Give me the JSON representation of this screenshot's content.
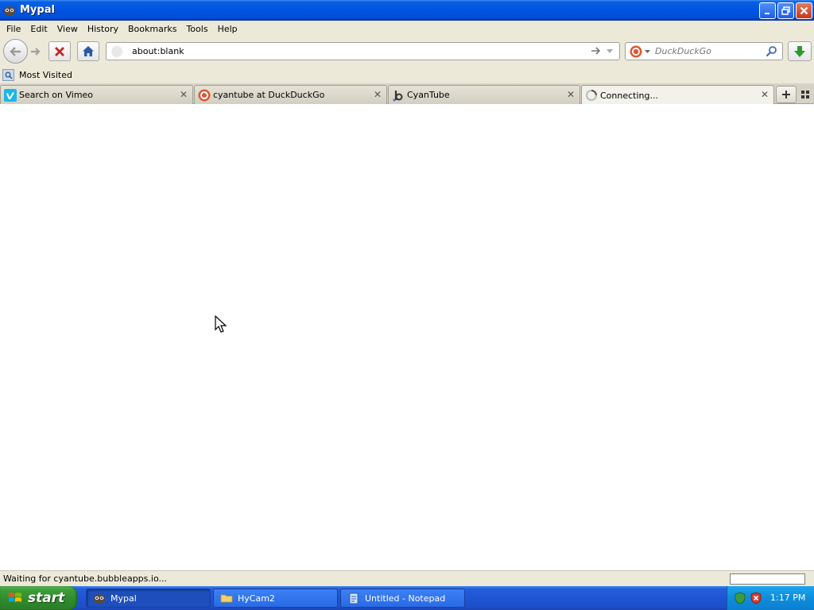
{
  "window": {
    "title": "Mypal"
  },
  "menubar": {
    "items": [
      "File",
      "Edit",
      "View",
      "History",
      "Bookmarks",
      "Tools",
      "Help"
    ]
  },
  "navbar": {
    "url": "about:blank",
    "search_placeholder": "DuckDuckGo",
    "icons": [
      "back-icon",
      "forward-icon",
      "stop-icon",
      "home-icon",
      "go-arrow-icon",
      "search-engine-icon",
      "search-icon",
      "download-icon"
    ]
  },
  "bookmarks": {
    "items": [
      "Most Visited"
    ]
  },
  "tabs": [
    {
      "label": "Search on Vimeo",
      "favicon": "vimeo-icon",
      "active": false
    },
    {
      "label": "cyantube at DuckDuckGo",
      "favicon": "duckduckgo-icon",
      "active": false
    },
    {
      "label": "CyanTube",
      "favicon": "bubble-icon",
      "active": false
    },
    {
      "label": "Connecting...",
      "favicon": "loading-icon",
      "active": true
    }
  ],
  "statusbar": {
    "text": "Waiting for cyantube.bubbleapps.io..."
  },
  "taskbar": {
    "start_label": "start",
    "tasks": [
      {
        "label": "Mypal",
        "icon": "mypal-icon",
        "active": true
      },
      {
        "label": "HyCam2",
        "icon": "folder-icon",
        "active": false
      },
      {
        "label": "Untitled - Notepad",
        "icon": "notepad-icon",
        "active": false
      }
    ],
    "clock": "1:17 PM"
  },
  "colors": {
    "titlebar_blue": "#0054e3",
    "chrome_beige": "#ece9d8",
    "start_green": "#3c9d3a",
    "taskbar_blue": "#245edb",
    "stop_red": "#c0282d",
    "download_green": "#2e9a2e"
  }
}
